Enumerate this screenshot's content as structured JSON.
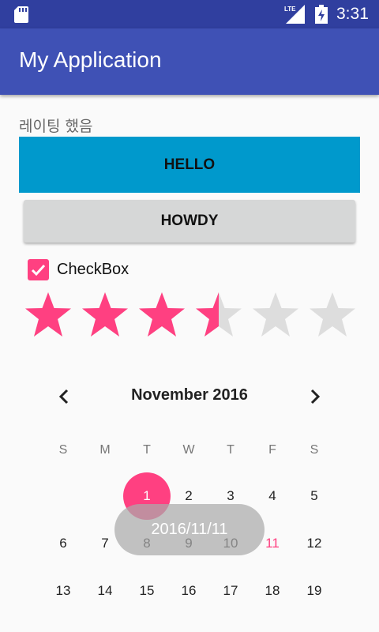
{
  "status_bar": {
    "network_label": "LTE",
    "time": "3:31",
    "icons": [
      "sd-card-icon",
      "lte-signal-icon",
      "battery-charging-icon"
    ]
  },
  "app_bar": {
    "title": "My Application"
  },
  "content": {
    "rating_label": "레이팅 했음",
    "hello_button": "HELLO",
    "howdy_button": "HOWDY",
    "checkbox": {
      "label": "CheckBox",
      "checked": true
    },
    "rating": {
      "value": 3.5,
      "max": 6
    }
  },
  "calendar": {
    "month_title": "November 2016",
    "prev_icon": "chevron-left-icon",
    "next_icon": "chevron-right-icon",
    "weekdays": [
      "S",
      "M",
      "T",
      "W",
      "T",
      "F",
      "S"
    ],
    "week1": [
      "1",
      "2",
      "3",
      "4",
      "5"
    ],
    "week2": [
      "6",
      "7",
      "8",
      "9",
      "10",
      "11",
      "12"
    ],
    "week3": [
      "13",
      "14",
      "15",
      "16",
      "17",
      "18",
      "19"
    ],
    "selected_day": "1",
    "today_day": "11"
  },
  "toast": {
    "text": "2016/11/11"
  },
  "colors": {
    "status_bar": "#303f9f",
    "app_bar": "#3f51b5",
    "accent": "#ff4081",
    "hello_button_bg": "#0099cc",
    "howdy_button_bg": "#d6d7d7",
    "star_empty": "#dddddd"
  }
}
